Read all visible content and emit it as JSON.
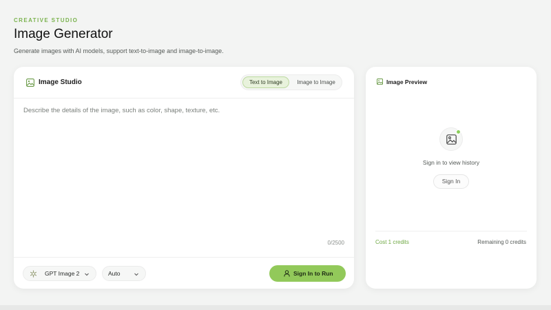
{
  "header": {
    "eyebrow": "CREATIVE STUDIO",
    "title": "Image Generator",
    "subtitle": "Generate images with AI models, support text-to-image and image-to-image."
  },
  "studio": {
    "title": "Image Studio",
    "icon": "image-icon",
    "modes": [
      {
        "label": "Text to Image",
        "active": true
      },
      {
        "label": "Image to Image",
        "active": false
      }
    ],
    "prompt": {
      "value": "",
      "placeholder": "Describe the details of the image, such as color, shape, texture, etc."
    },
    "char_count": "0/2500",
    "model": {
      "label": "GPT Image 2",
      "icon": "openai-logo-icon"
    },
    "ratio": {
      "label": "Auto"
    },
    "run_button": {
      "label": "Sign In to Run",
      "icon": "user-icon"
    }
  },
  "preview": {
    "title": "Image Preview",
    "icon": "image-icon",
    "empty_message": "Sign in to view history",
    "signin_label": "Sign In",
    "cost": "Cost 1 credits",
    "remaining": "Remaining 0 credits"
  },
  "colors": {
    "accent": "#92c95a",
    "accent_text": "#7bb34f",
    "background": "#f3f4f3",
    "card": "#ffffff"
  }
}
